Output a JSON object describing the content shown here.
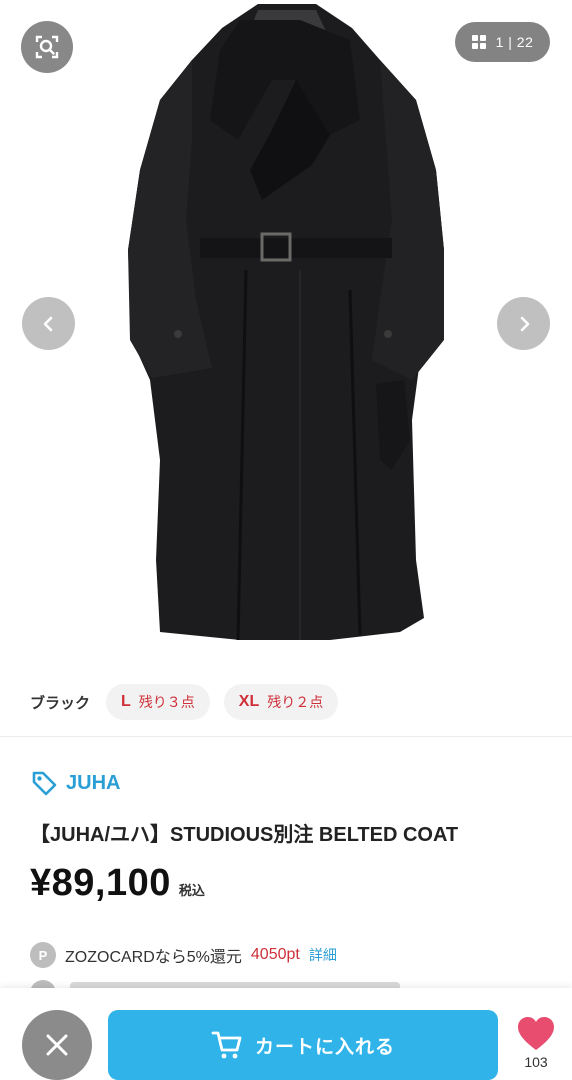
{
  "gallery": {
    "counter": "1 | 22",
    "icons": {
      "search": "image-search-icon",
      "grid": "grid-icon",
      "prev": "chevron-left-icon",
      "next": "chevron-right-icon"
    }
  },
  "variants": {
    "color_label": "ブラック",
    "chips": [
      {
        "size": "L",
        "stock": "残り３点"
      },
      {
        "size": "XL",
        "stock": "残り２点"
      }
    ]
  },
  "product": {
    "brand": "JUHA",
    "title": "【JUHA/ユハ】STUDIOUS別注 BELTED COAT",
    "price": "¥89,100",
    "tax_label": "税込"
  },
  "points": {
    "badge": "P",
    "text": "ZOZOCARDなら5%還元",
    "value": "4050pt",
    "detail_label": "詳細"
  },
  "bottom_bar": {
    "cart_label": "カートに入れる",
    "favorite_count": "103",
    "icons": {
      "close": "close-icon",
      "cart": "cart-icon",
      "favorite": "heart-icon"
    }
  },
  "colors": {
    "accent_blue": "#2fb3e8",
    "link_blue": "#2a9fd6",
    "stock_red": "#d0303a",
    "heart_pink": "#e84c6e"
  }
}
